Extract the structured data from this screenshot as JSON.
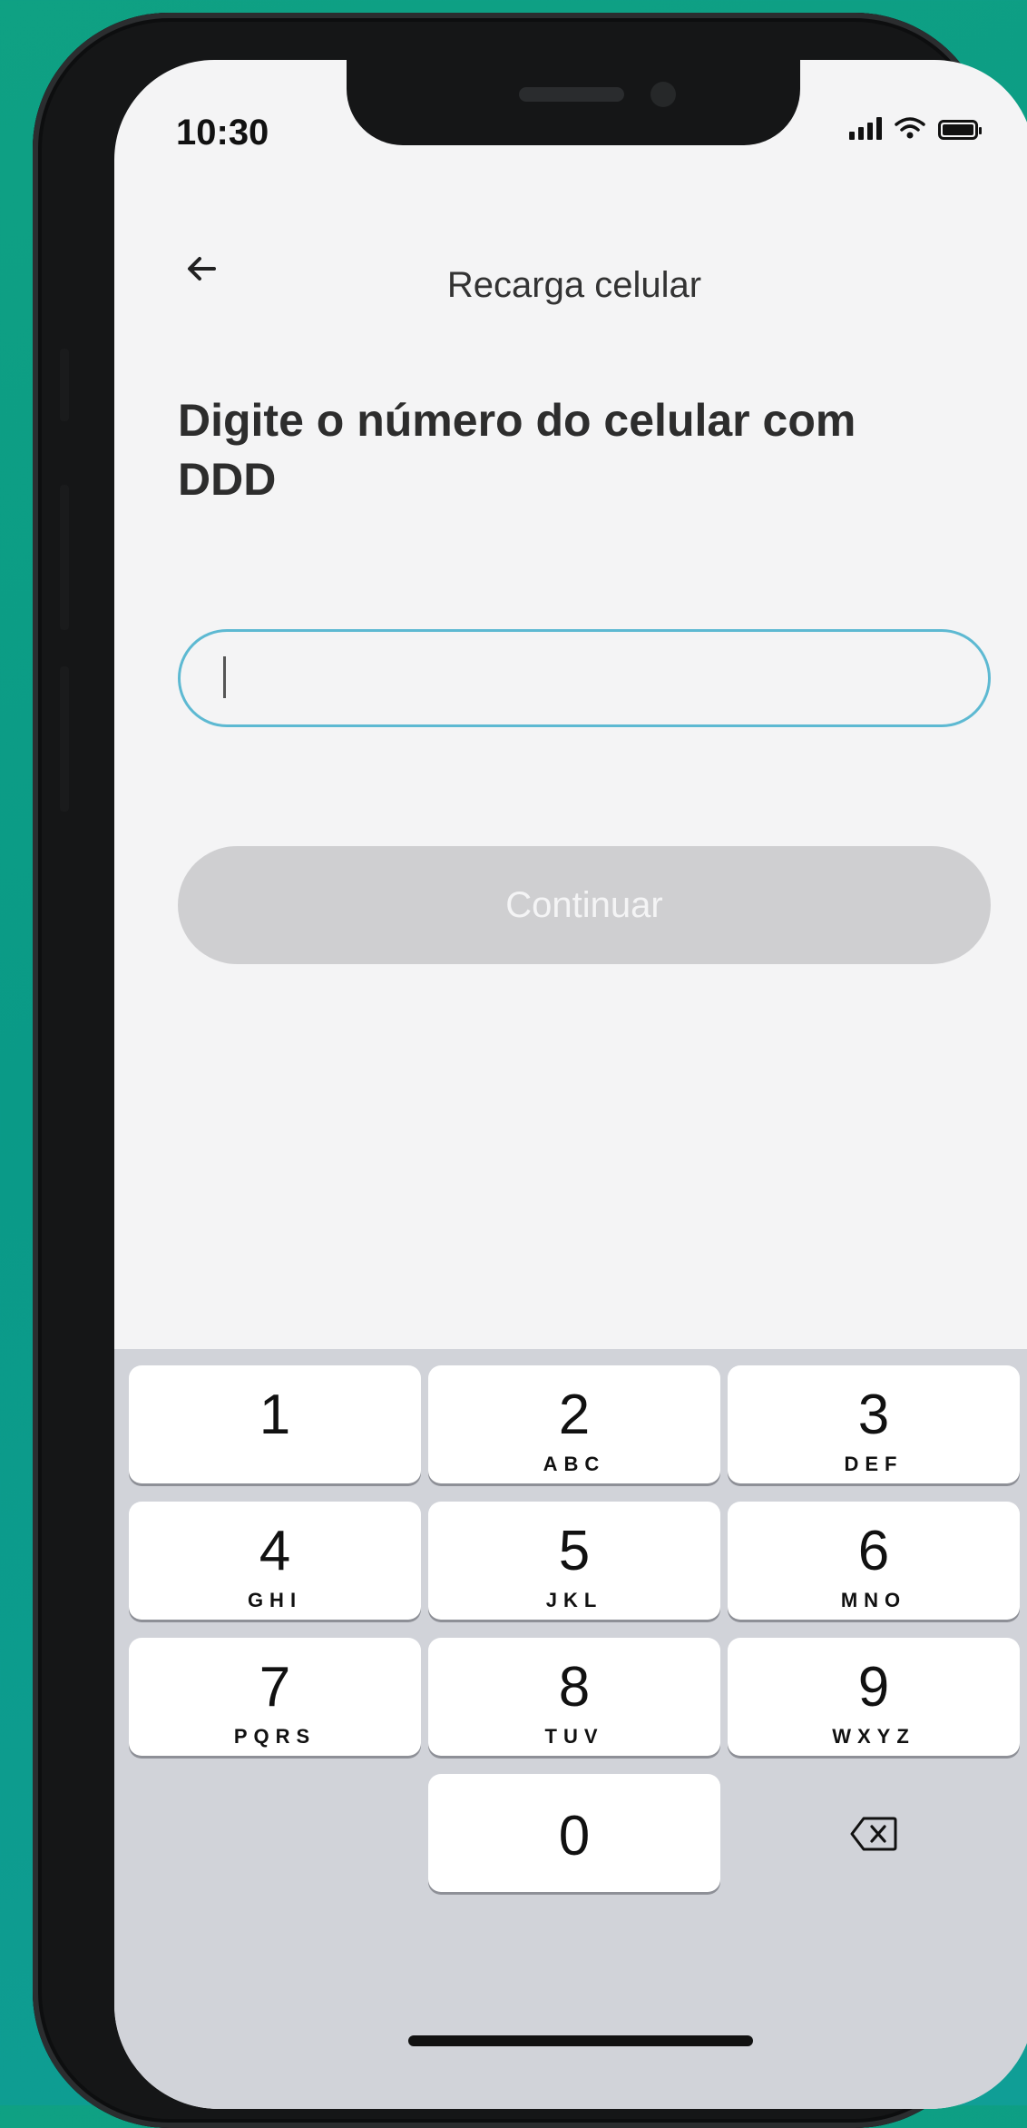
{
  "status_bar": {
    "time": "10:30"
  },
  "header": {
    "title": "Recarga celular"
  },
  "main": {
    "heading": "Digite o número do celular com DDD",
    "phone_input": {
      "value": "",
      "placeholder": ""
    },
    "continue_label": "Continuar"
  },
  "keypad": {
    "keys": [
      {
        "digit": "1",
        "letters": ""
      },
      {
        "digit": "2",
        "letters": "ABC"
      },
      {
        "digit": "3",
        "letters": "DEF"
      },
      {
        "digit": "4",
        "letters": "GHI"
      },
      {
        "digit": "5",
        "letters": "JKL"
      },
      {
        "digit": "6",
        "letters": "MNO"
      },
      {
        "digit": "7",
        "letters": "PQRS"
      },
      {
        "digit": "8",
        "letters": "TUV"
      },
      {
        "digit": "9",
        "letters": "WXYZ"
      },
      {
        "digit": "0",
        "letters": ""
      }
    ]
  },
  "colors": {
    "background_accent": "#0fa183",
    "input_border": "#5db9d2",
    "disabled_button": "#cfcfd1",
    "keypad_background": "#d1d3d9"
  },
  "icons": [
    "back-arrow-icon",
    "signal-icon",
    "wifi-icon",
    "battery-icon",
    "backspace-icon"
  ]
}
